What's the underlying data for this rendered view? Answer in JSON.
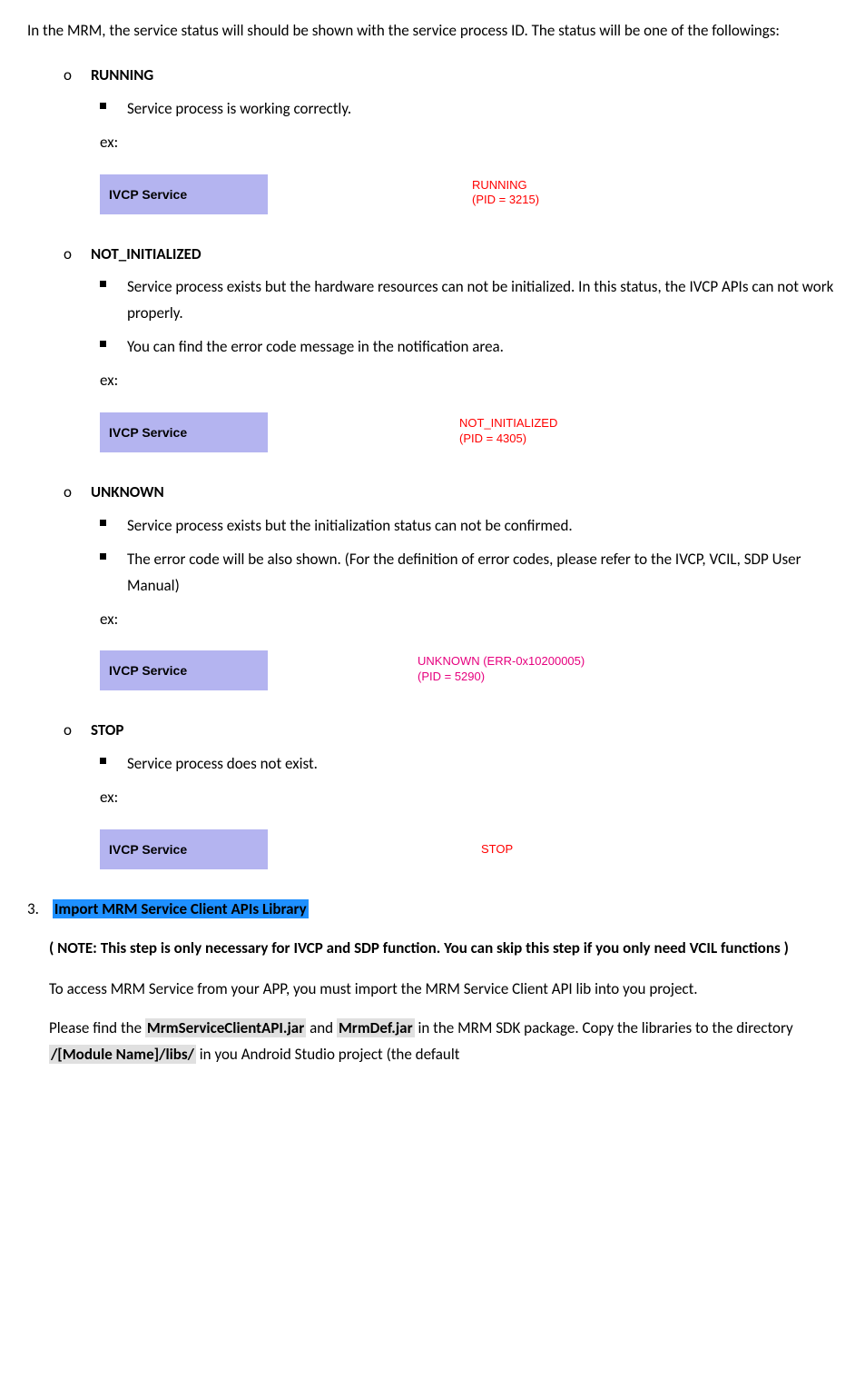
{
  "intro": " In the MRM, the service status will should be shown with the service process ID. The status will be one of the followings:",
  "statuses": [
    {
      "name": "RUNNING",
      "bullets": [
        "Service process is working correctly."
      ],
      "ex": "ex:",
      "box": "IVCP Service",
      "status_line1": "RUNNING",
      "status_line2": "(PID = 3215)",
      "color": "status-red",
      "sleft": 410
    },
    {
      "name": "NOT_INITIALIZED",
      "bullets": [
        "Service process exists but the hardware resources can not be initialized. In this status, the IVCP APIs can not work properly.",
        "You can find the error code message in the notification area."
      ],
      "ex": "ex:",
      "box": "IVCP Service",
      "status_line1": "NOT_INITIALIZED",
      "status_line2": "(PID = 4305)",
      "color": "status-red",
      "sleft": 396
    },
    {
      "name": "UNKNOWN",
      "bullets": [
        "Service process exists but the initialization status can not be confirmed.",
        "The error code will be also shown. (For the definition of error codes, please refer to the IVCP, VCIL, SDP User Manual)"
      ],
      "ex": "ex:",
      "box": "IVCP Service",
      "status_line1": "UNKNOWN (ERR-0x10200005)",
      "status_line2": "(PID = 5290)",
      "color": "status-pink",
      "sleft": 350
    },
    {
      "name": "STOP",
      "bullets": [
        "Service process does not exist."
      ],
      "ex": "ex:",
      "box": "IVCP Service",
      "status_line1": "STOP",
      "status_line2": "",
      "color": "status-red",
      "sleft": 420
    }
  ],
  "section": {
    "num": "3.",
    "title": "Import MRM Service Client APIs Library",
    "note": "( NOTE: This step is only necessary for IVCP and SDP function. You can skip this step if you only need VCIL functions )",
    "p1": "To access MRM Service from your APP, you must import the MRM Service Client API lib into you project.",
    "p2_a": "Please find the ",
    "p2_jar1": "MrmServiceClientAPI.jar",
    "p2_b": " and ",
    "p2_jar2": "MrmDef.jar",
    "p2_c": " in the MRM SDK package. Copy the libraries to the directory ",
    "p2_path": "/[Module Name]/libs/",
    "p2_d": "  in you Android Studio project  (the default"
  }
}
